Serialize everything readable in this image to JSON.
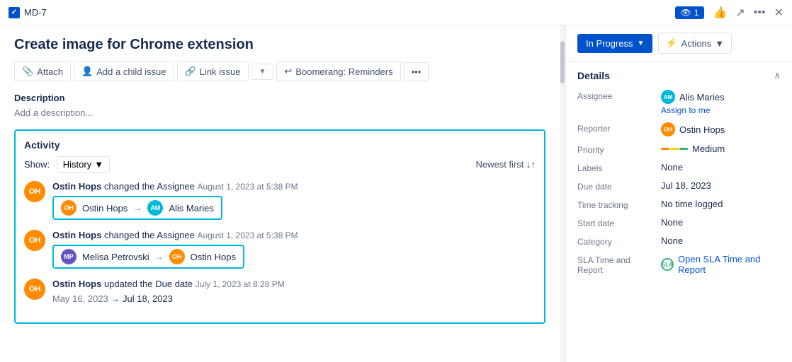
{
  "topbar": {
    "issue_id": "MD-7",
    "watch_count": "1",
    "watch_label": "1"
  },
  "page": {
    "title": "Create image for Chrome extension"
  },
  "toolbar": {
    "attach_label": "Attach",
    "add_child_label": "Add a child issue",
    "link_issue_label": "Link issue",
    "boomerang_label": "Boomerang: Reminders"
  },
  "description": {
    "title": "Description",
    "placeholder": "Add a description..."
  },
  "activity": {
    "title": "Activity",
    "show_label": "Show:",
    "filter": "History",
    "sort": "Newest first ↓↑",
    "entries": [
      {
        "author": "Ostin Hops",
        "action": "changed the Assignee",
        "time": "August 1, 2023 at 5:38 PM",
        "from_name": "Ostin Hops",
        "to_name": "Alis Maries",
        "from_initials": "OH",
        "to_initials": "AM",
        "from_color": "#ff8b00",
        "to_color": "#00b8d9"
      },
      {
        "author": "Ostin Hops",
        "action": "changed the Assignee",
        "time": "August 1, 2023 at 5:38 PM",
        "from_name": "Melisa Petrovski",
        "to_name": "Ostin Hops",
        "from_initials": "MP",
        "to_initials": "OH",
        "from_color": "#6554c0",
        "to_color": "#ff8b00"
      },
      {
        "author": "Ostin Hops",
        "action": "updated the Due date",
        "time": "July 1, 2023 at 8:28 PM",
        "date_from": "May 16, 2023",
        "date_to": "Jul 18, 2023"
      }
    ]
  },
  "right_panel": {
    "status": "In Progress",
    "actions": "Actions",
    "details_title": "Details",
    "assignee_label": "Assignee",
    "assignee_name": "Alis Maries",
    "assignee_initials": "AM",
    "assign_me": "Assign to me",
    "reporter_label": "Reporter",
    "reporter_name": "Ostin Hops",
    "reporter_initials": "OH",
    "priority_label": "Priority",
    "priority_value": "Medium",
    "labels_label": "Labels",
    "labels_value": "None",
    "due_date_label": "Due date",
    "due_date_value": "Jul 18, 2023",
    "time_tracking_label": "Time tracking",
    "time_tracking_value": "No time logged",
    "start_date_label": "Start date",
    "start_date_value": "None",
    "category_label": "Category",
    "category_value": "None",
    "sla_label": "SLA Time and Report",
    "sla_value": "Open SLA Time and Report"
  }
}
